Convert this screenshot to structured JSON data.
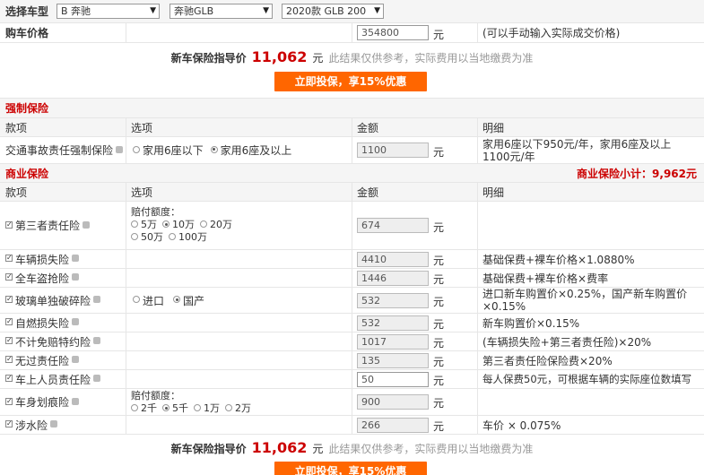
{
  "header": {
    "select_label": "选择车型",
    "brand": "B 奔驰",
    "series": "奔驰GLB",
    "model": "2020款 GLB 200"
  },
  "price": {
    "label": "购车价格",
    "value": "354800",
    "unit": "元",
    "hint": "(可以手动输入实际成交价格)"
  },
  "guide": {
    "label": "新车保险指导价",
    "amount": "11,062",
    "unit": "元",
    "note": "此结果仅供参考，实际费用以当地缴费为准",
    "button": "立即投保，享15%优惠"
  },
  "compulsory": {
    "title": "强制保险",
    "headers": [
      "款项",
      "选项",
      "金额",
      "明细"
    ],
    "item": {
      "name": "交通事故责任强制保险",
      "opt1": "家用6座以下",
      "opt2": "家用6座及以上",
      "amount": "1100",
      "unit": "元",
      "detail": "家用6座以下950元/年，家用6座及以上1100元/年"
    }
  },
  "commercial": {
    "title": "商业保险",
    "subtotal": "商业保险小计：9,962元",
    "headers": [
      "款项",
      "选项",
      "金额",
      "明细"
    ],
    "third_party": {
      "name": "第三者责任险",
      "option_label": "赔付额度：",
      "options": [
        "5万",
        "10万",
        "20万",
        "50万",
        "100万"
      ],
      "amount": "674",
      "unit": "元"
    },
    "vehicle_loss": {
      "name": "车辆损失险",
      "amount": "4410",
      "unit": "元",
      "detail": "基础保费+裸车价格×1.0880%"
    },
    "theft": {
      "name": "全车盗抢险",
      "amount": "1446",
      "unit": "元",
      "detail": "基础保费+裸车价格×费率"
    },
    "glass": {
      "name": "玻璃单独破碎险",
      "opt1": "进口",
      "opt2": "国产",
      "amount": "532",
      "unit": "元",
      "detail": "进口新车购置价×0.25%，国产新车购置价×0.15%"
    },
    "fire": {
      "name": "自燃损失险",
      "amount": "532",
      "unit": "元",
      "detail": "新车购置价×0.15%"
    },
    "deductible": {
      "name": "不计免赔特约险",
      "amount": "1017",
      "unit": "元",
      "detail": "(车辆损失险+第三者责任险)×20%"
    },
    "no_fault": {
      "name": "无过责任险",
      "amount": "135",
      "unit": "元",
      "detail": "第三者责任险保险费×20%"
    },
    "passenger": {
      "name": "车上人员责任险",
      "amount": "50",
      "unit": "元",
      "detail": "每人保费50元，可根据车辆的实际座位数填写"
    },
    "scratch": {
      "name": "车身划痕险",
      "option_label": "赔付额度：",
      "options": [
        "2千",
        "5千",
        "1万",
        "2万"
      ],
      "amount": "900",
      "unit": "元"
    },
    "wading": {
      "name": "涉水险",
      "amount": "266",
      "unit": "元",
      "detail": "车价 × 0.075%"
    }
  }
}
